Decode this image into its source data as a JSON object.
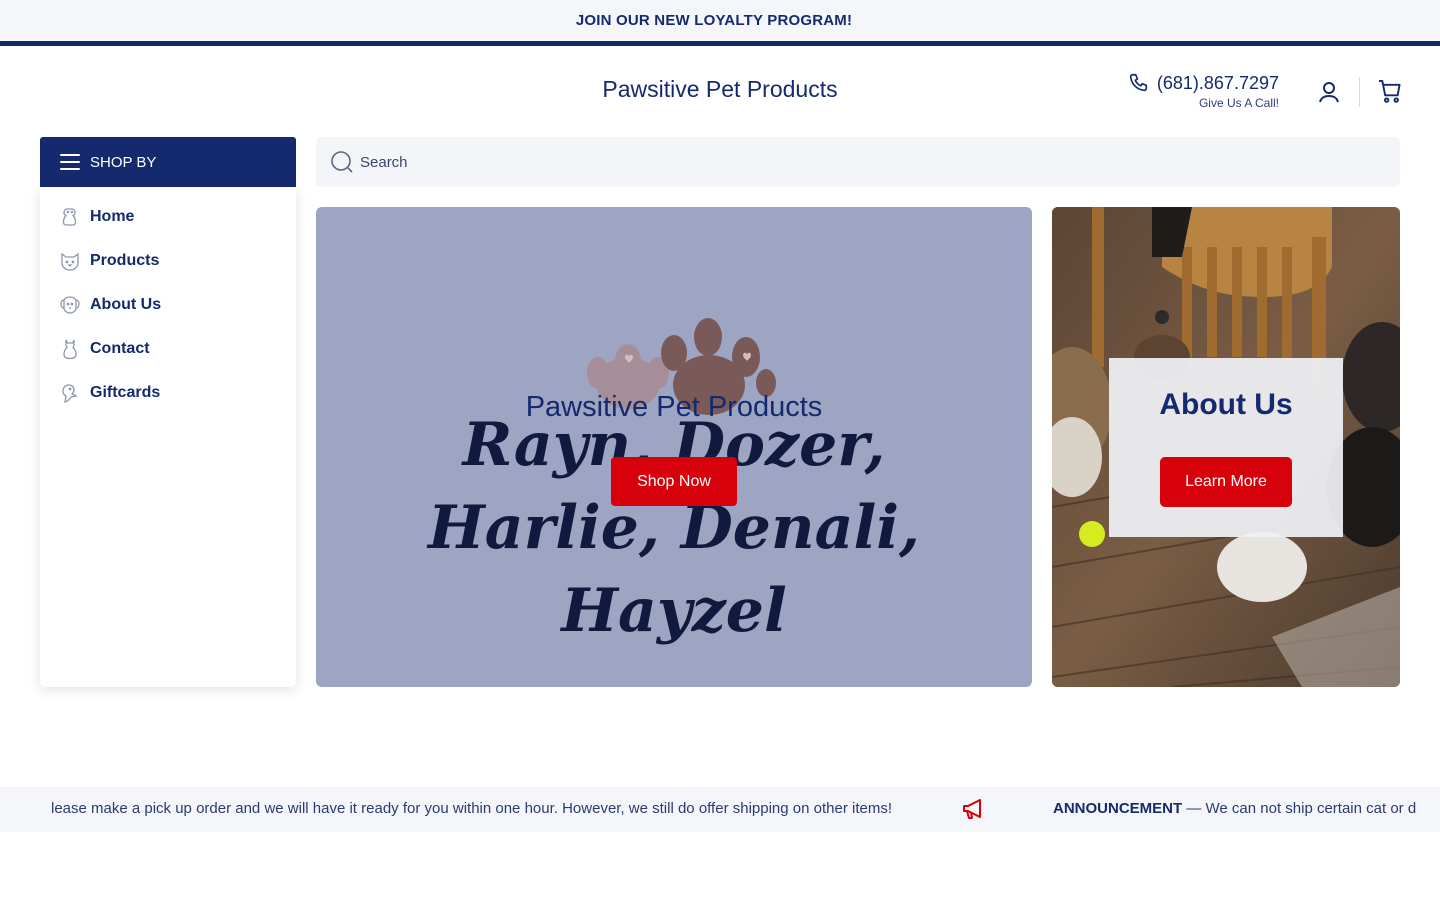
{
  "announcement_bar": {
    "text": "JOIN OUR NEW LOYALTY PROGRAM!"
  },
  "header": {
    "brand": "Pawsitive Pet Products",
    "phone": {
      "number": "(681).867.7297",
      "caption": "Give Us A Call!",
      "icon": "phone-icon"
    },
    "account_icon": "user-icon",
    "cart_icon": "cart-icon"
  },
  "sidebar": {
    "shop_by_label": "SHOP BY",
    "items": [
      {
        "label": "Home",
        "icon": "dog-icon"
      },
      {
        "label": "Products",
        "icon": "cat-face-icon"
      },
      {
        "label": "About Us",
        "icon": "puppy-face-icon"
      },
      {
        "label": "Contact",
        "icon": "sitting-cat-icon"
      },
      {
        "label": "Giftcards",
        "icon": "bird-icon"
      }
    ]
  },
  "search": {
    "placeholder": "Search",
    "value": ""
  },
  "hero": {
    "title": "Pawsitive Pet Products",
    "names": [
      "Rayn, Dozer,",
      "Harlie, Denali,",
      "Hayzel"
    ],
    "button_label": "Shop Now",
    "background_color": "#9ea5c2"
  },
  "about_banner": {
    "title": "About Us",
    "button_label": "Learn More"
  },
  "ticker": {
    "message_tail": "lease make a pick up order and we will have it ready for you within one hour. However, we still do offer shipping on other items!",
    "icon": "megaphone-icon",
    "heading": "ANNOUNCEMENT",
    "message_head": " — We can not ship certain cat or d"
  },
  "colors": {
    "brand_navy": "#152a6e",
    "accent_red": "#d7010b",
    "light_bg": "#f5f6fa"
  }
}
